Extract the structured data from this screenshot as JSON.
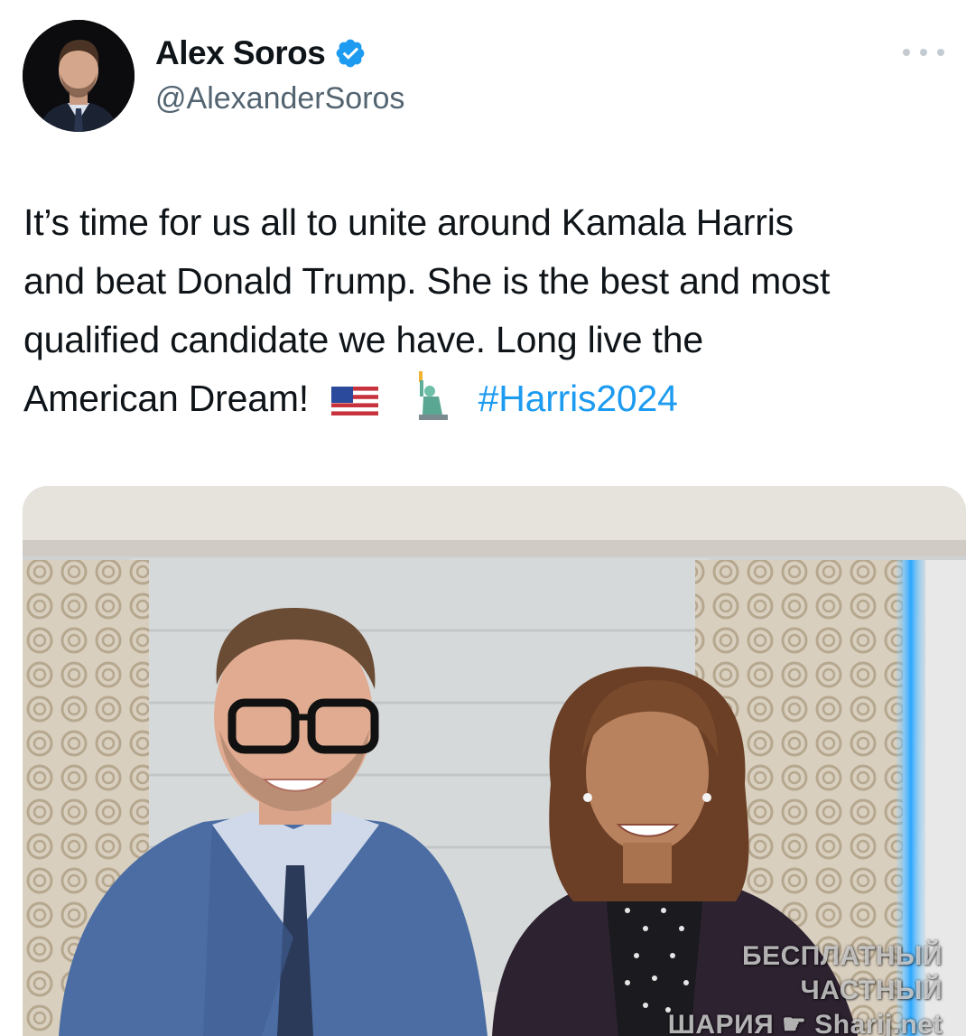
{
  "author": {
    "display_name": "Alex Soros",
    "handle": "@AlexanderSoros",
    "verified": true,
    "avatar_icon": "profile-photo-avatar"
  },
  "menu": {
    "icon": "more-options-icon"
  },
  "tweet": {
    "lines": [
      "It’s time for us all to unite around Kamala Harris",
      "and beat Donald Trump. She is the best and most",
      "qualified candidate we have. Long live the",
      "American Dream!"
    ],
    "emojis": [
      "us-flag-icon",
      "statue-of-liberty-icon"
    ],
    "hashtag": "#Harris2024"
  },
  "media": {
    "icon": "attached-photo"
  },
  "watermark": {
    "line1": "БЕСПЛАТНЫЙ ЧАСТНЫЙ",
    "line2": "ШАРИЯ",
    "line2_suffix": "Sharij.net"
  },
  "colors": {
    "link": "#1d9bf0",
    "verified_badge": "#1d9bf0",
    "secondary_text": "#536471"
  }
}
